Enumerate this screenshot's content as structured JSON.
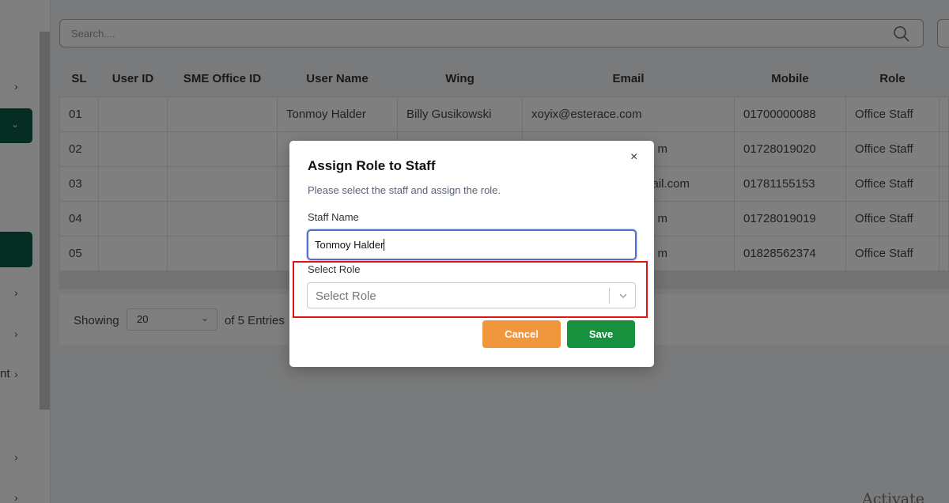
{
  "search": {
    "placeholder": "Search...."
  },
  "sidebar": {
    "partial_text": "nt"
  },
  "table": {
    "headers": [
      "SL",
      "User ID",
      "SME Office ID",
      "User Name",
      "Wing",
      "Email",
      "Mobile",
      "Role"
    ],
    "rows": [
      [
        "01",
        "",
        "",
        "Tonmoy Halder",
        "Billy Gusikowski",
        "xoyix@esterace.com",
        "01700000088",
        "Office Staff"
      ],
      [
        "02",
        "",
        "",
        "",
        "",
        "m",
        "01728019020",
        "Office Staff"
      ],
      [
        "03",
        "",
        "",
        "",
        "",
        "ail.com",
        "01781155153",
        "Office Staff"
      ],
      [
        "04",
        "",
        "",
        "",
        "",
        "m",
        "01728019019",
        "Office Staff"
      ],
      [
        "05",
        "",
        "",
        "",
        "",
        "m",
        "01828562374",
        "Office Staff"
      ]
    ]
  },
  "pagination": {
    "showing_label": "Showing",
    "per_page": "20",
    "entries_text": "of 5 Entries"
  },
  "modal": {
    "title": "Assign Role to Staff",
    "subtitle": "Please select the staff and assign the role.",
    "staff_label": "Staff Name",
    "staff_value": "Tonmoy Halder",
    "role_label": "Select Role",
    "role_placeholder": "Select Role",
    "cancel_label": "Cancel",
    "save_label": "Save",
    "close_glyph": "×"
  },
  "watermark": {
    "text": "Activate Wi"
  },
  "colors": {
    "save": "#17913e",
    "cancel": "#f0973d",
    "sidebar_active": "#0d5a46",
    "highlight": "#e01212"
  }
}
